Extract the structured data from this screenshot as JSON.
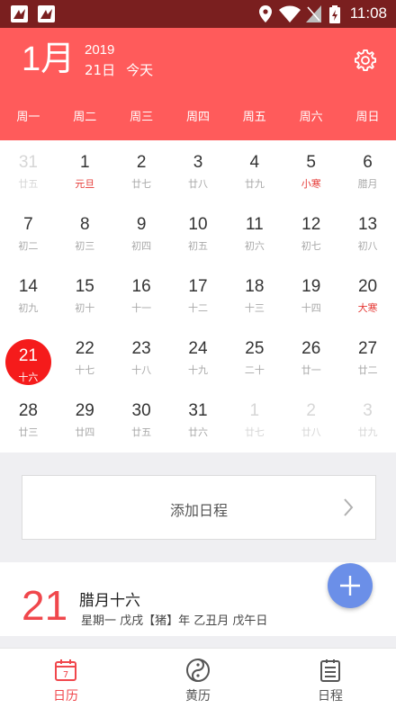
{
  "status_bar": {
    "time": "11:08"
  },
  "header": {
    "month": "1月",
    "year": "2019",
    "day": "21日",
    "today_label": "今天",
    "weekdays": [
      "周一",
      "周二",
      "周三",
      "周四",
      "周五",
      "周六",
      "周日"
    ]
  },
  "calendar": {
    "weeks": [
      [
        {
          "d": "31",
          "l": "廿五",
          "other": true
        },
        {
          "d": "1",
          "l": "元旦",
          "red": true
        },
        {
          "d": "2",
          "l": "廿七"
        },
        {
          "d": "3",
          "l": "廿八"
        },
        {
          "d": "4",
          "l": "廿九"
        },
        {
          "d": "5",
          "l": "小寒",
          "red": true
        },
        {
          "d": "6",
          "l": "腊月"
        }
      ],
      [
        {
          "d": "7",
          "l": "初二"
        },
        {
          "d": "8",
          "l": "初三"
        },
        {
          "d": "9",
          "l": "初四"
        },
        {
          "d": "10",
          "l": "初五"
        },
        {
          "d": "11",
          "l": "初六"
        },
        {
          "d": "12",
          "l": "初七"
        },
        {
          "d": "13",
          "l": "初八"
        }
      ],
      [
        {
          "d": "14",
          "l": "初九"
        },
        {
          "d": "15",
          "l": "初十"
        },
        {
          "d": "16",
          "l": "十一"
        },
        {
          "d": "17",
          "l": "十二"
        },
        {
          "d": "18",
          "l": "十三"
        },
        {
          "d": "19",
          "l": "十四"
        },
        {
          "d": "20",
          "l": "大寒",
          "red": true
        }
      ],
      [
        {
          "d": "21",
          "l": "十六",
          "today": true
        },
        {
          "d": "22",
          "l": "十七"
        },
        {
          "d": "23",
          "l": "十八"
        },
        {
          "d": "24",
          "l": "十九"
        },
        {
          "d": "25",
          "l": "二十"
        },
        {
          "d": "26",
          "l": "廿一"
        },
        {
          "d": "27",
          "l": "廿二"
        }
      ],
      [
        {
          "d": "28",
          "l": "廿三"
        },
        {
          "d": "29",
          "l": "廿四"
        },
        {
          "d": "30",
          "l": "廿五"
        },
        {
          "d": "31",
          "l": "廿六"
        },
        {
          "d": "1",
          "l": "廿七",
          "other": true
        },
        {
          "d": "2",
          "l": "廿八",
          "other": true
        },
        {
          "d": "3",
          "l": "廿九",
          "other": true
        }
      ]
    ]
  },
  "add_schedule": {
    "label": "添加日程"
  },
  "detail": {
    "day": "21",
    "lunar": "腊月十六",
    "ganzhi": "星期一 戊戌【猪】年 乙丑月 戊午日"
  },
  "tabs": [
    {
      "label": "日历",
      "icon": "calendar-icon",
      "active": true
    },
    {
      "label": "黄历",
      "icon": "yin-yang-icon",
      "active": false
    },
    {
      "label": "日程",
      "icon": "schedule-icon",
      "active": false
    }
  ],
  "colors": {
    "accent": "#ff5b5b",
    "status_bar": "#7a1f1f",
    "today": "#f51b1b",
    "fab": "#6b8fe8"
  }
}
